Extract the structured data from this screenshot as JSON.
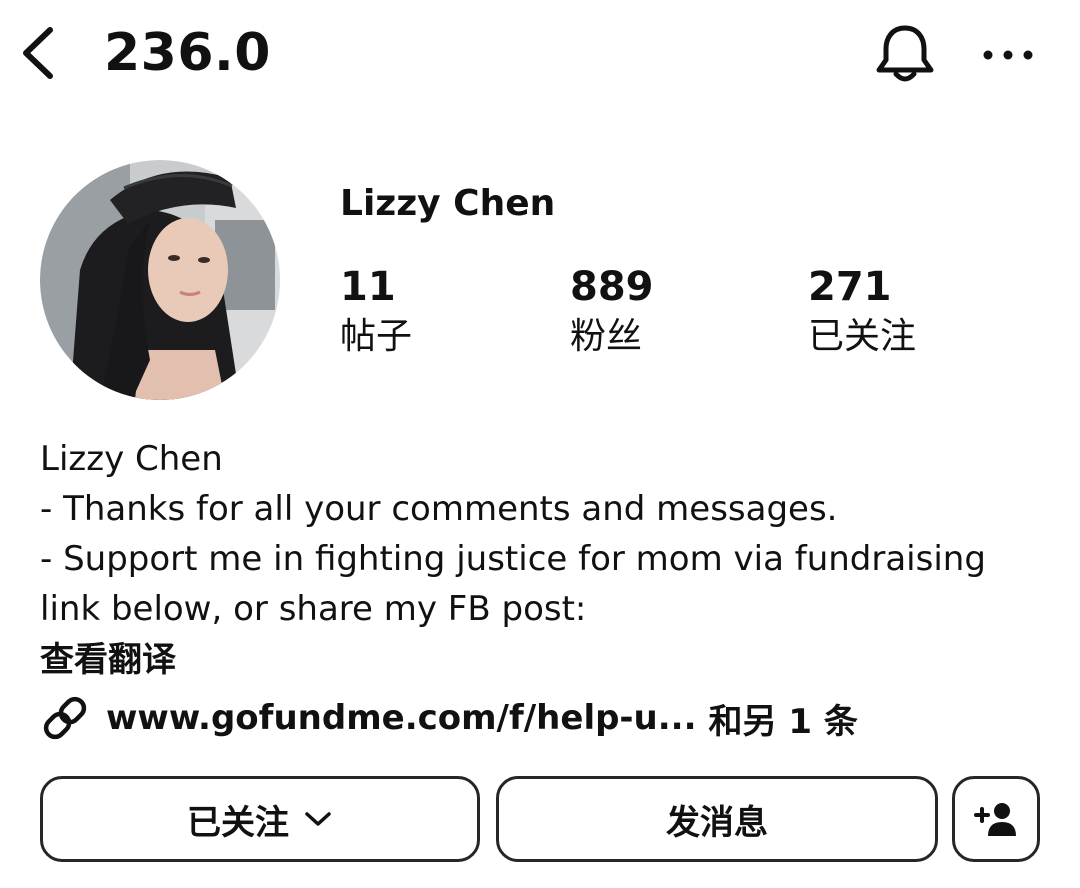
{
  "header": {
    "username": "236.0",
    "back_icon": "chevron-left-icon",
    "notification_icon": "bell-icon",
    "more_icon": "more-horizontal-icon"
  },
  "profile": {
    "display_name": "Lizzy Chen",
    "avatar": "profile-photo",
    "stats": [
      {
        "value": "11",
        "label": "帖子"
      },
      {
        "value": "889",
        "label": "粉丝"
      },
      {
        "value": "271",
        "label": "已关注"
      }
    ]
  },
  "bio": {
    "lines": [
      "Lizzy Chen",
      "- Thanks for all your comments and messages.",
      "- Support me in fighting justice for mom via fundraising",
      "link below, or share my FB post:"
    ],
    "translate_label": "查看翻译",
    "link": {
      "icon": "link-icon",
      "url": "www.gofundme.com/f/help-u...",
      "more_label": "和另 1 条"
    }
  },
  "actions": {
    "following_label": "已关注",
    "message_label": "发消息",
    "add_icon": "add-person-icon"
  },
  "colors": {
    "text": "#111111",
    "button_border": "#262626",
    "background": "#ffffff"
  }
}
